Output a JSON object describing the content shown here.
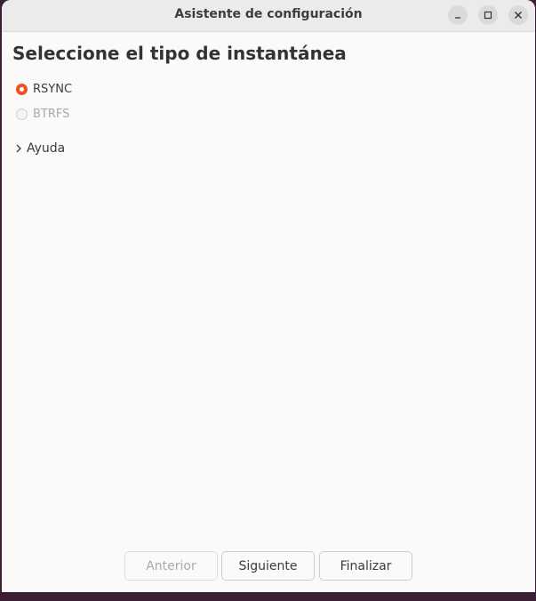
{
  "window": {
    "title": "Asistente de configuración"
  },
  "page": {
    "heading": "Seleccione el tipo de instantánea"
  },
  "snapshot_types": [
    {
      "label": "RSYNC",
      "selected": true,
      "enabled": true
    },
    {
      "label": "BTRFS",
      "selected": false,
      "enabled": false
    }
  ],
  "help": {
    "label": "Ayuda",
    "expanded": false
  },
  "buttons": {
    "previous": "Anterior",
    "next": "Siguiente",
    "finish": "Finalizar"
  },
  "colors": {
    "accent": "#e95420"
  }
}
